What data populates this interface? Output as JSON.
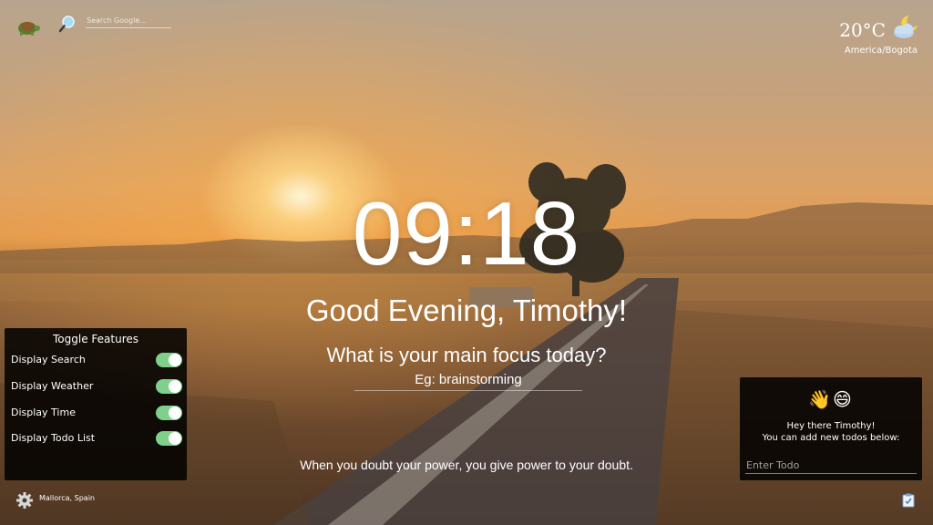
{
  "search": {
    "placeholder": "Search Google..."
  },
  "weather": {
    "temperature": "20°C",
    "timezone": "America/Bogota",
    "icon": "partly-cloudy-night-icon"
  },
  "clock": {
    "time": "09:18"
  },
  "greeting": {
    "text": "Good Evening, Timothy!"
  },
  "focus": {
    "question": "What is your main focus today?",
    "placeholder": "Eg: brainstorming"
  },
  "quote": {
    "text": "When you doubt your power, you give power to your doubt."
  },
  "toggles": {
    "title": "Toggle Features",
    "items": [
      {
        "label": "Display Search",
        "on": true
      },
      {
        "label": "Display Weather",
        "on": true
      },
      {
        "label": "Display Time",
        "on": true
      },
      {
        "label": "Display Todo List",
        "on": true
      }
    ]
  },
  "location": {
    "text": "Mallorca, Spain"
  },
  "todo": {
    "emojis": [
      "👋",
      "😄"
    ],
    "greeting": "Hey there Timothy!",
    "subtitle": "You can add new todos below:",
    "placeholder": "Enter Todo"
  },
  "colors": {
    "toggle_on": "#7ed08a",
    "panel_bg": "#000000"
  }
}
